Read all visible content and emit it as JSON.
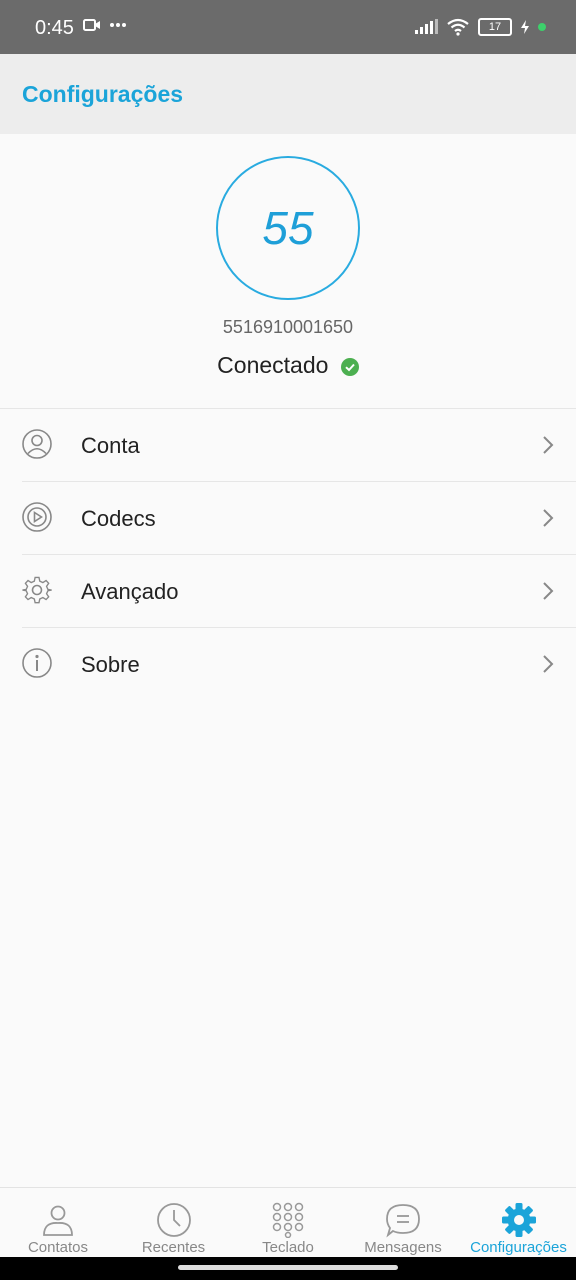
{
  "status_bar": {
    "time": "0:45",
    "battery_level": "17",
    "icons": [
      "video-camera-icon",
      "more-dots-icon",
      "signal-icon",
      "wifi-icon",
      "battery-icon",
      "charging-icon"
    ]
  },
  "header": {
    "title": "Configurações"
  },
  "profile": {
    "avatar_text": "55",
    "account_number": "5516910001650",
    "status_text": "Conectado",
    "status_color": "#4caf50"
  },
  "menu": {
    "items": [
      {
        "label": "Conta",
        "icon": "user-icon"
      },
      {
        "label": "Codecs",
        "icon": "codec-icon"
      },
      {
        "label": "Avançado",
        "icon": "gear-icon"
      },
      {
        "label": "Sobre",
        "icon": "info-icon"
      }
    ]
  },
  "bottom_nav": {
    "items": [
      {
        "label": "Contatos",
        "icon": "contacts-icon"
      },
      {
        "label": "Recentes",
        "icon": "clock-icon"
      },
      {
        "label": "Teclado",
        "icon": "keypad-icon"
      },
      {
        "label": "Mensagens",
        "icon": "message-icon"
      },
      {
        "label": "Configurações",
        "icon": "settings-icon",
        "active": true
      }
    ]
  },
  "colors": {
    "accent": "#1ba4d9",
    "header_bg": "#ededed",
    "status_bar_bg": "#6b6b6b"
  }
}
